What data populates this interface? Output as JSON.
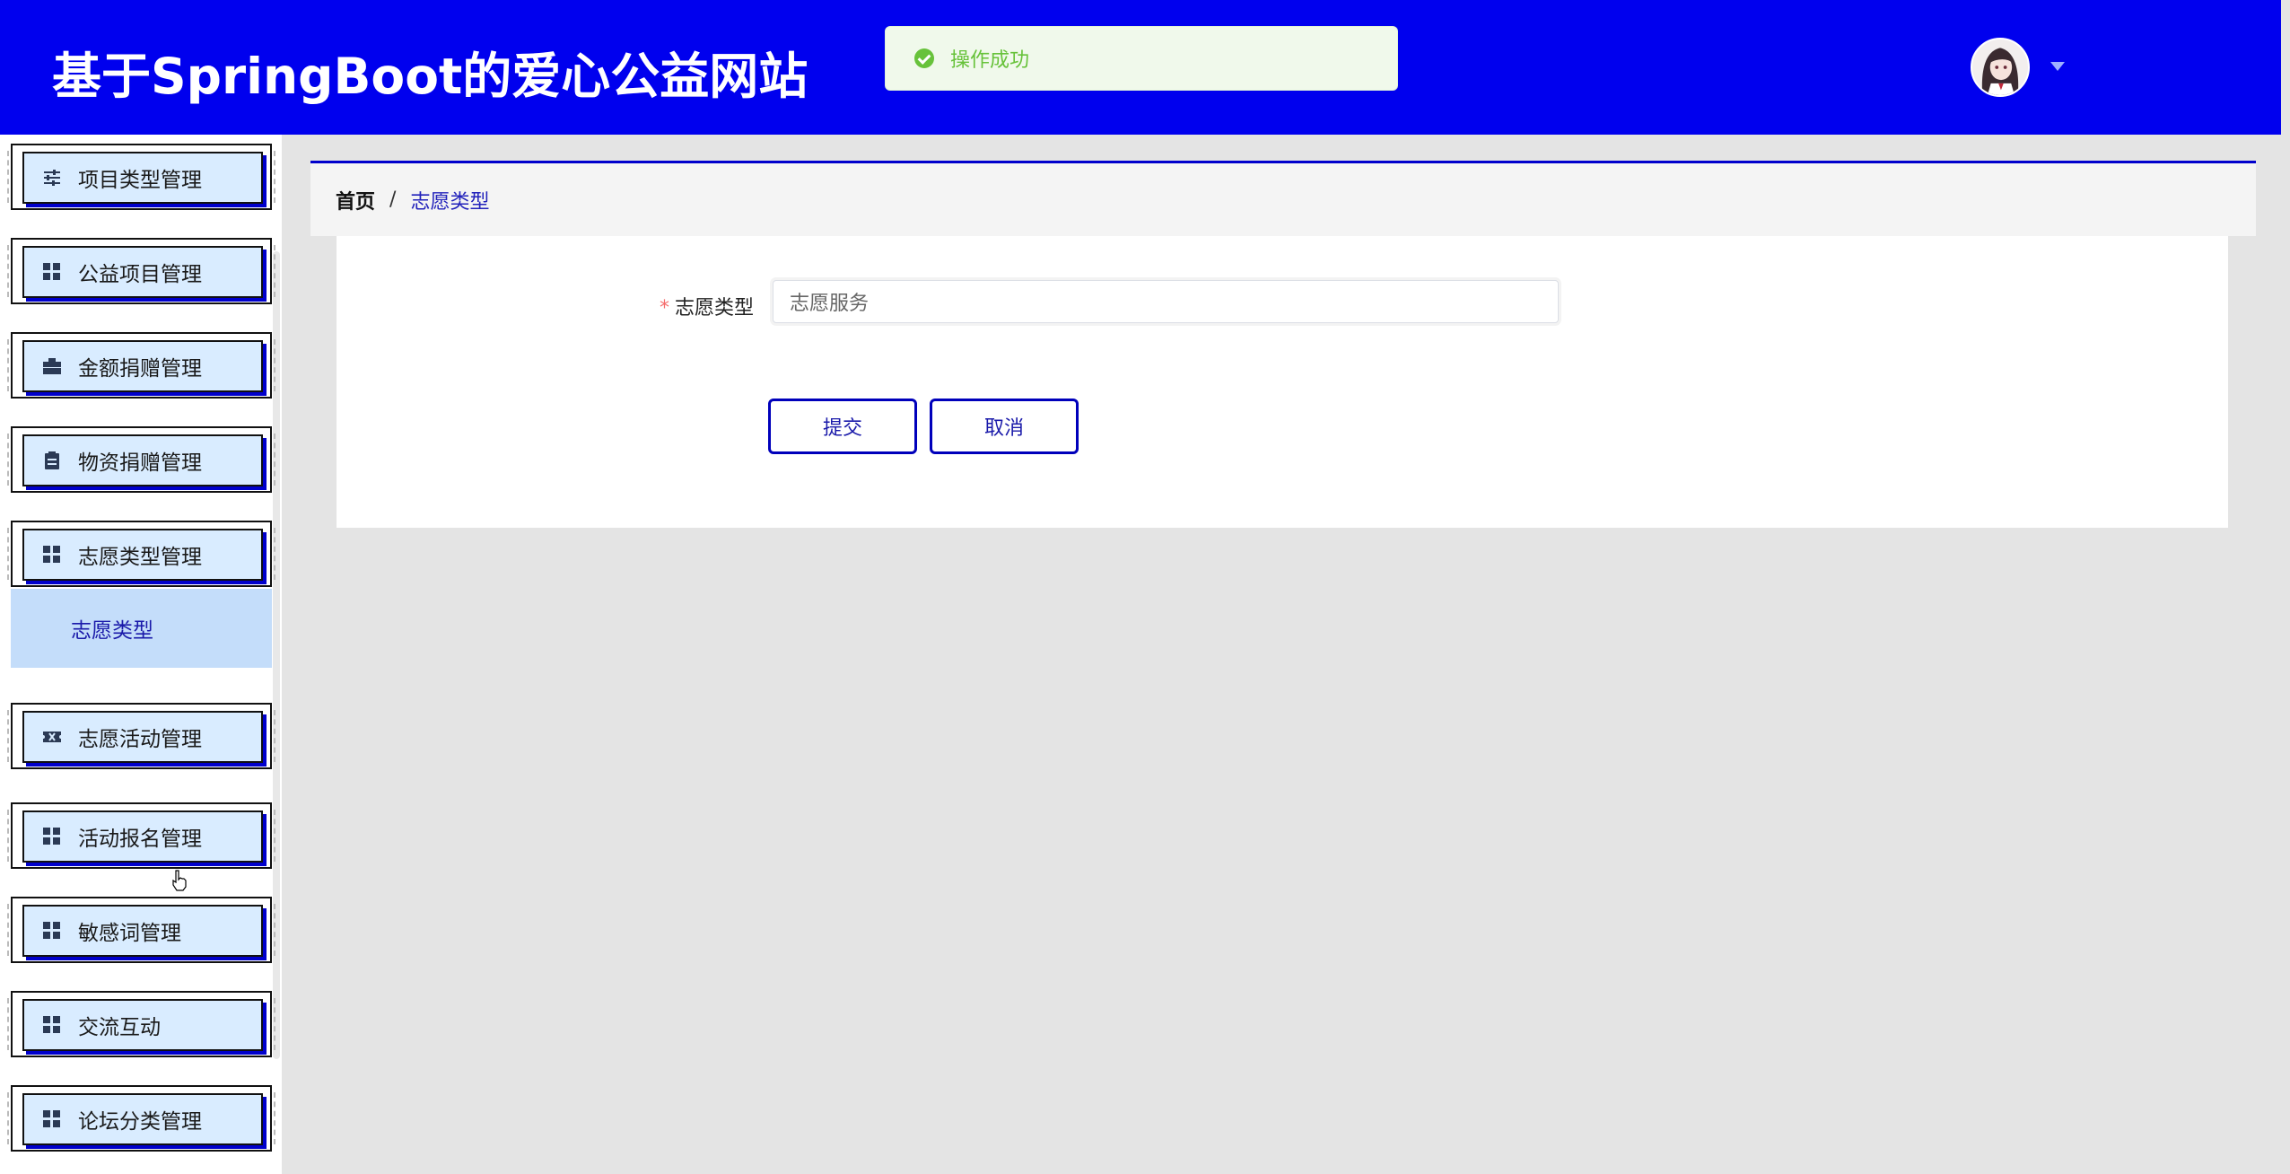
{
  "header": {
    "title": "基于SpringBoot的爱心公益网站",
    "toast": "操作成功",
    "colors": {
      "header_bg": "#0000ee",
      "toast_text": "#67c23a"
    }
  },
  "sidebar": {
    "items": [
      {
        "label": "项目类型管理",
        "icon": "sliders-icon"
      },
      {
        "label": "公益项目管理",
        "icon": "grid-icon"
      },
      {
        "label": "金额捐赠管理",
        "icon": "briefcase-icon"
      },
      {
        "label": "物资捐赠管理",
        "icon": "clipboard-icon"
      },
      {
        "label": "志愿类型管理",
        "icon": "grid-icon"
      },
      {
        "label": "志愿活动管理",
        "icon": "ticket-icon"
      },
      {
        "label": "活动报名管理",
        "icon": "grid-icon"
      },
      {
        "label": "敏感词管理",
        "icon": "grid-icon"
      },
      {
        "label": "交流互动",
        "icon": "grid-icon"
      },
      {
        "label": "论坛分类管理",
        "icon": "grid-icon"
      }
    ],
    "active_submenu": {
      "label": "志愿类型"
    }
  },
  "breadcrumb": {
    "home": "首页",
    "separator": "/",
    "current": "志愿类型"
  },
  "form": {
    "label": "志愿类型",
    "required_mark": "*",
    "input_value": "志愿服务",
    "submit_label": "提交",
    "cancel_label": "取消"
  }
}
